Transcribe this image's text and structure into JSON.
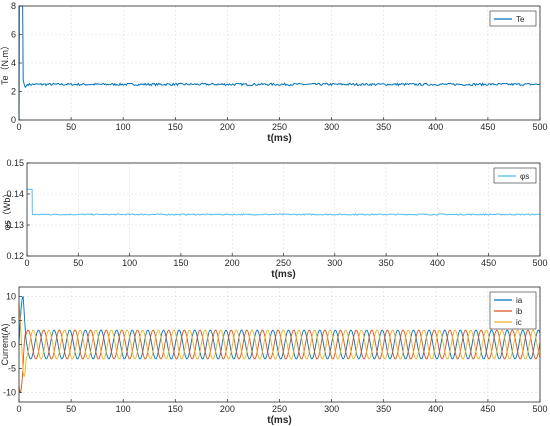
{
  "chart_data": [
    {
      "type": "line",
      "xlabel": "t(ms)",
      "ylabel": "Te（N.m）",
      "xlim": [
        0,
        500
      ],
      "ylim": [
        0,
        8
      ],
      "xticks": [
        "0",
        "50",
        "100",
        "150",
        "200",
        "250",
        "300",
        "350",
        "400",
        "450",
        "500"
      ],
      "yticks": [
        "0",
        "2",
        "4",
        "6",
        "8"
      ],
      "grid": true,
      "legend_position": "top-right",
      "series": [
        {
          "name": "Te",
          "color": "#0072BD",
          "x": [
            0,
            0.3,
            3.5,
            4,
            5,
            6,
            8,
            10,
            100,
            200,
            300,
            400,
            500
          ],
          "y": [
            0,
            8,
            8,
            2.8,
            2.5,
            2.3,
            2.5,
            2.5,
            2.5,
            2.5,
            2.5,
            2.5,
            2.5
          ],
          "ripple": 0.08
        }
      ]
    },
    {
      "type": "line",
      "xlabel": "t(ms)",
      "ylabel": "φs（Wb）",
      "xlim": [
        0,
        500
      ],
      "ylim": [
        0.12,
        0.15
      ],
      "xticks": [
        "0",
        "50",
        "100",
        "150",
        "200",
        "250",
        "300",
        "350",
        "400",
        "450",
        "500"
      ],
      "yticks": [
        "0.12",
        "0.13",
        "0.14",
        "0.15"
      ],
      "grid": true,
      "legend_position": "top-right",
      "series": [
        {
          "name": "φs",
          "color": "#4DBEEE",
          "x": [
            0,
            0.3,
            5,
            5.2,
            500
          ],
          "y": [
            0.1415,
            0.1415,
            0.1415,
            0.1334,
            0.1334
          ],
          "ripple": 0.0002
        }
      ]
    },
    {
      "type": "line",
      "xlabel": "t(ms)",
      "ylabel": "Current(A)",
      "xlim": [
        0,
        500
      ],
      "ylim": [
        -12,
        12
      ],
      "xticks": [
        "0",
        "50",
        "100",
        "150",
        "200",
        "250",
        "300",
        "350",
        "400",
        "450",
        "500"
      ],
      "yticks": [
        "-10",
        "-5",
        "0",
        "5",
        "10"
      ],
      "grid": true,
      "legend_position": "top-right",
      "frequency_hz": 66.7,
      "amplitude_A": 3,
      "startup_peak_A": 10,
      "series": [
        {
          "name": "ia",
          "color": "#0072BD",
          "phase_deg": 0
        },
        {
          "name": "ib",
          "color": "#D95319",
          "phase_deg": -120
        },
        {
          "name": "ic",
          "color": "#EDB120",
          "phase_deg": 120
        }
      ]
    }
  ]
}
